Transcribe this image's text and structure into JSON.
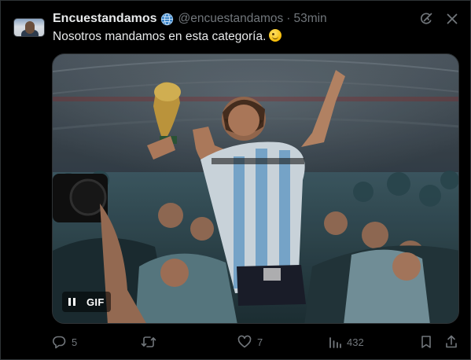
{
  "tweet": {
    "display_name": "Encuestandamos",
    "handle": "@encuestandamos",
    "separator": "·",
    "time": "53min",
    "text": "Nosotros mandamos en esta categoría.",
    "emoji": "winking-face",
    "media": {
      "type": "gif",
      "label": "GIF",
      "state": "playing"
    },
    "metrics": {
      "replies": "5",
      "likes": "7",
      "views": "432"
    }
  },
  "icons": {
    "verified_badge": "globe-icon",
    "grok": "grok-icon",
    "more": "close-icon",
    "reply": "reply-icon",
    "retweet": "retweet-icon",
    "like": "heart-icon",
    "views": "views-icon",
    "bookmark": "bookmark-icon",
    "share": "share-icon"
  },
  "colors": {
    "background": "#000000",
    "text_primary": "#e7e9ea",
    "text_secondary": "#71767b",
    "border": "#2f3336"
  }
}
